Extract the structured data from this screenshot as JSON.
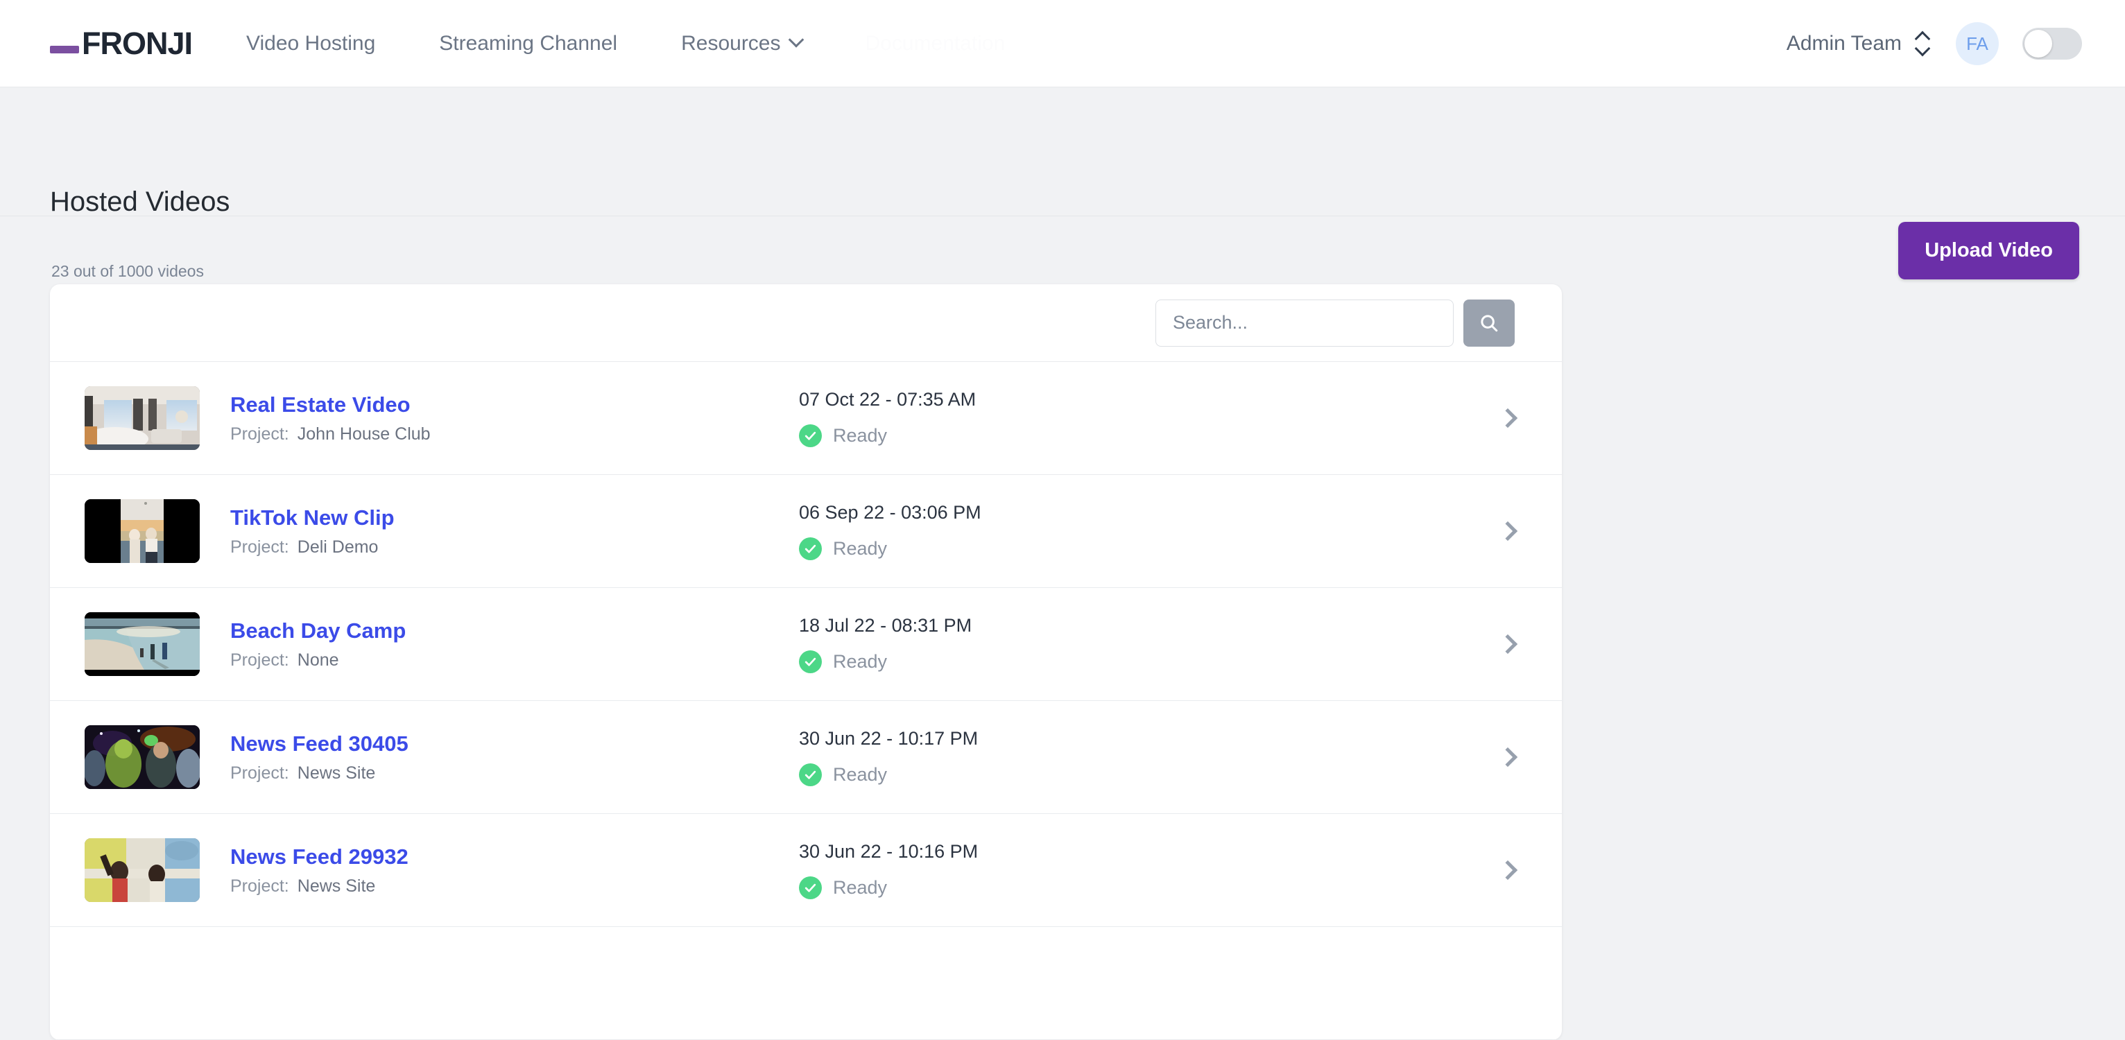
{
  "nav": {
    "logo": "FRONJI",
    "links": [
      {
        "label": "Video Hosting",
        "has_caret": false
      },
      {
        "label": "Streaming Channel",
        "has_caret": false
      },
      {
        "label": "Resources",
        "has_caret": true
      }
    ],
    "ghost_link": "Documentation",
    "team": "Admin Team",
    "avatar_initials": "FA",
    "toggle_state": "off"
  },
  "header": {
    "title": "Hosted Videos",
    "subtitle": "23 out of 1000 videos",
    "upload_label": "Upload Video"
  },
  "search": {
    "value": "",
    "placeholder": "Search..."
  },
  "list": {
    "project_label": "Project:",
    "rows": [
      {
        "title": "Real Estate Video",
        "project": "John House Club",
        "date": "07 Oct 22 - 07:35 AM",
        "status": "Ready",
        "thumb": "hotel-room"
      },
      {
        "title": "TikTok New Clip",
        "project": "Deli Demo",
        "date": "06 Sep 22 - 03:06 PM",
        "status": "Ready",
        "thumb": "portrait-indoor"
      },
      {
        "title": "Beach Day Camp",
        "project": "None",
        "date": "18 Jul 22 - 08:31 PM",
        "status": "Ready",
        "thumb": "beach-sunset"
      },
      {
        "title": "News Feed 30405",
        "project": "News Site",
        "date": "30 Jun 22 - 10:17 PM",
        "status": "Ready",
        "thumb": "night-party"
      },
      {
        "title": "News Feed 29932",
        "project": "News Site",
        "date": "30 Jun 22 - 10:16 PM",
        "status": "Ready",
        "thumb": "outdoor-people"
      },
      {
        "title": "",
        "project": "",
        "date": "",
        "status": "",
        "thumb": "none"
      }
    ]
  },
  "colors": {
    "brand_purple": "#6B2FA8",
    "logo_accent": "#7B4FA0",
    "link_blue": "#3B4BE8",
    "status_green": "#4CD787",
    "page_bg": "#F1F2F4"
  }
}
